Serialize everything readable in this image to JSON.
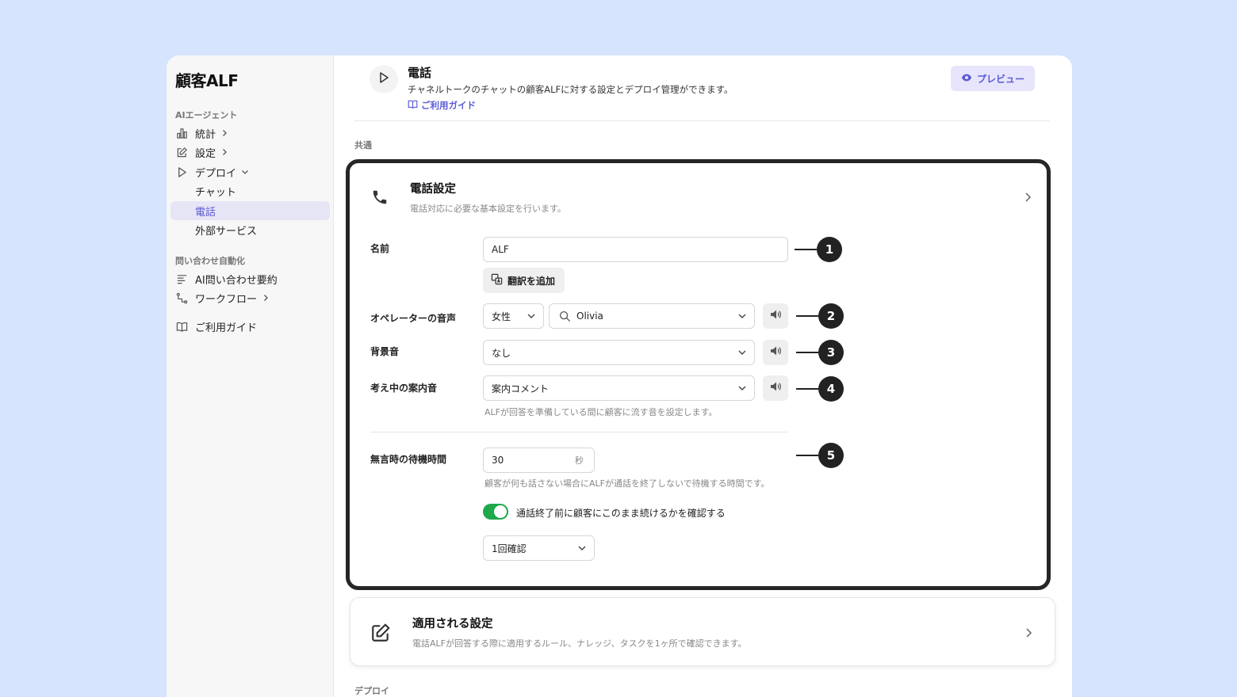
{
  "sidebar": {
    "brand": "顧客ALF",
    "section_ai": "AIエージェント",
    "items": [
      {
        "label": "統計",
        "icon": "bar-chart-icon"
      },
      {
        "label": "設定",
        "icon": "edit-icon"
      },
      {
        "label": "デプロイ",
        "icon": "play-icon"
      },
      {
        "label": "チャット"
      },
      {
        "label": "電話",
        "active": true
      },
      {
        "label": "外部サービス"
      }
    ],
    "section_auto": "問い合わせ自動化",
    "auto_items": [
      {
        "label": "AI問い合わせ要約",
        "icon": "summary-icon"
      },
      {
        "label": "ワークフロー",
        "icon": "workflow-icon"
      }
    ],
    "guide": "ご利用ガイド"
  },
  "header": {
    "title": "電話",
    "description": "チャネルトークのチャットの顧客ALFに対する設定とデプロイ管理ができます。",
    "guide_link": "ご利用ガイド",
    "preview_button": "プレビュー"
  },
  "sections": {
    "common": "共通",
    "deploy": "デプロイ"
  },
  "phone_settings": {
    "title": "電話設定",
    "description": "電話対応に必要な基本設定を行います。",
    "name_label": "名前",
    "name_value": "ALF",
    "translate_button": "翻訳を追加",
    "voice_label": "オペレーターの音声",
    "gender_value": "女性",
    "voice_value": "Olivia",
    "bg_label": "背景音",
    "bg_value": "なし",
    "thinking_label": "考え中の案内音",
    "thinking_value": "案内コメント",
    "thinking_help": "ALFが回答を準備している間に顧客に流す音を設定します。",
    "silence_label": "無言時の待機時間",
    "silence_value": "30",
    "silence_unit": "秒",
    "silence_help": "顧客が何も話さない場合にALFが通話を終了しないで待機する時間です。",
    "confirm_toggle_label": "通話終了前に顧客にこのまま続けるかを確認する",
    "confirm_toggle_on": true,
    "confirm_count_value": "1回確認"
  },
  "applied_settings": {
    "title": "適用される設定",
    "description": "電話ALFが回答する際に適用するルール、ナレッジ、タスクを1ヶ所で確認できます。"
  },
  "callouts": [
    "1",
    "2",
    "3",
    "4",
    "5"
  ],
  "colors": {
    "background": "#d6e4fd",
    "accent": "#5b5bd6",
    "toggle_on": "#1ea84b",
    "highlight_border": "#262626"
  }
}
